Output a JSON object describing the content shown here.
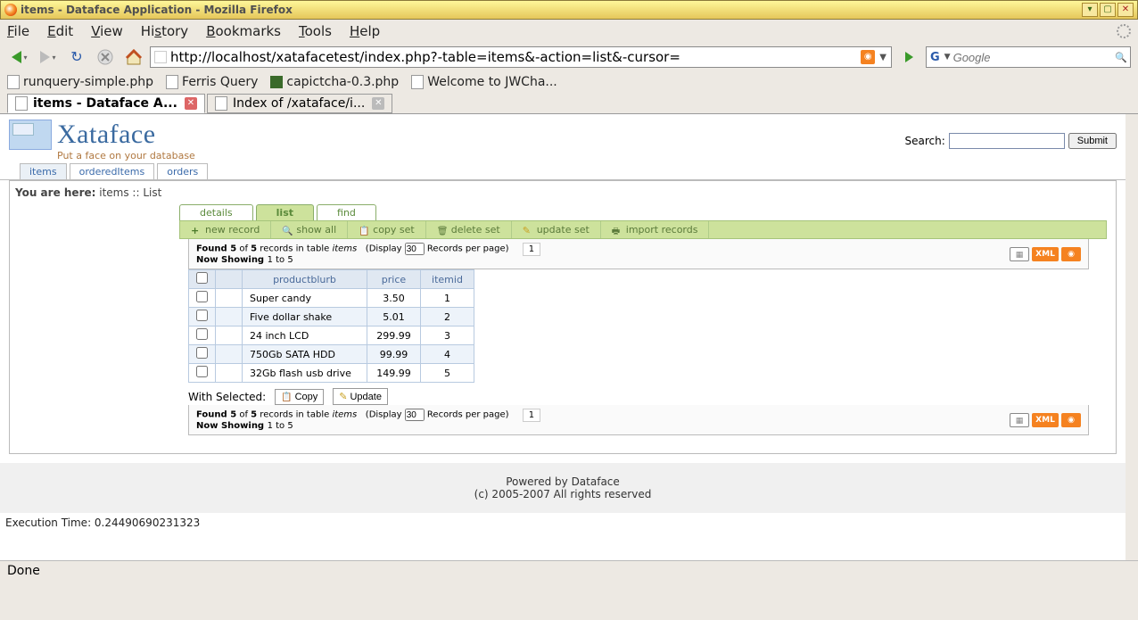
{
  "window": {
    "title": "items - Dataface Application - Mozilla Firefox"
  },
  "menubar": {
    "file": "File",
    "edit": "Edit",
    "view": "View",
    "history": "History",
    "bookmarks": "Bookmarks",
    "tools": "Tools",
    "help": "Help"
  },
  "url": "http://localhost/xatafacetest/index.php?-table=items&-action=list&-cursor=",
  "search_placeholder": "Google",
  "bookmarks_bar": {
    "b1": "runquery-simple.php",
    "b2": "Ferris Query",
    "b3": "capictcha-0.3.php",
    "b4": "Welcome to JWCha..."
  },
  "tabs": {
    "t1": "items - Dataface A...",
    "t2": "Index of /xataface/i..."
  },
  "logo": {
    "name": "Xataface",
    "tagline": "Put a face on your database"
  },
  "search": {
    "label": "Search:",
    "submit": "Submit"
  },
  "apptabs": {
    "items": "items",
    "ordered": "orderedItems",
    "orders": "orders"
  },
  "breadcrumb": {
    "prefix": "You are here:",
    "path": " items :: List "
  },
  "viewtabs": {
    "details": "details",
    "list": "list",
    "find": "find"
  },
  "actions": {
    "new": "new record",
    "showall": "show all",
    "copyset": "copy set",
    "deleteset": "delete set",
    "updateset": "update set",
    "import": "import records"
  },
  "results": {
    "found_a": "Found ",
    "found_b": "5",
    "found_c": " of ",
    "found_d": "5",
    "found_e": " records in table ",
    "tablename": "items",
    "display_a": "(Display ",
    "perpage": "30",
    "display_b": " Records per page)",
    "now_a": "Now Showing ",
    "range": "1 to 5",
    "page1": "1",
    "xml": "XML"
  },
  "columns": {
    "c1": "productblurb",
    "c2": "price",
    "c3": "itemid"
  },
  "rows": [
    {
      "productblurb": "Super candy",
      "price": "3.50",
      "itemid": "1"
    },
    {
      "productblurb": "Five dollar shake",
      "price": "5.01",
      "itemid": "2"
    },
    {
      "productblurb": "24 inch LCD",
      "price": "299.99",
      "itemid": "3"
    },
    {
      "productblurb": "750Gb SATA HDD",
      "price": "99.99",
      "itemid": "4"
    },
    {
      "productblurb": "32Gb flash usb drive",
      "price": "149.99",
      "itemid": "5"
    }
  ],
  "withselected": {
    "label": "With Selected:",
    "copy": "Copy",
    "update": "Update"
  },
  "footer": {
    "l1": "Powered by Dataface",
    "l2": "(c) 2005-2007 All rights reserved"
  },
  "exectime": "Execution Time: 0.24490690231323",
  "status": "Done"
}
